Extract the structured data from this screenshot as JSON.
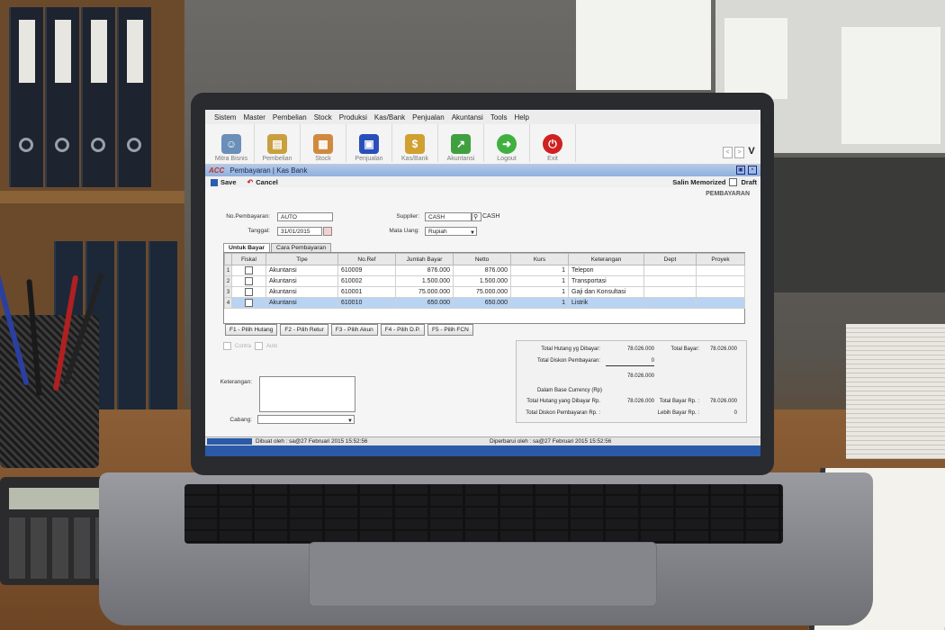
{
  "menu": [
    "Sistem",
    "Master",
    "Pembelian",
    "Stock",
    "Produksi",
    "Kas/Bank",
    "Penjualan",
    "Akuntansi",
    "Tools",
    "Help"
  ],
  "toolbar": [
    {
      "label": "Mitra Bisnis",
      "icon": "people-icon",
      "color": "#6a8fb8"
    },
    {
      "label": "Pembelian",
      "icon": "cart-icon",
      "color": "#c8a040"
    },
    {
      "label": "Stock",
      "icon": "boxes-icon",
      "color": "#d08a40"
    },
    {
      "label": "Penjualan",
      "icon": "bag-icon",
      "color": "#2a4fb8"
    },
    {
      "label": "Kas/Bank",
      "icon": "money-bag-icon",
      "color": "#d0a030"
    },
    {
      "label": "Akuntansi",
      "icon": "chart-icon",
      "color": "#40a040"
    },
    {
      "label": "Logout",
      "icon": "logout-icon",
      "color": "#40b040"
    },
    {
      "label": "Exit",
      "icon": "power-icon",
      "color": "#d02020"
    }
  ],
  "nav": {
    "prev": "<",
    "next": ">",
    "v": "V"
  },
  "window": {
    "logo": "ACC",
    "title": "Pembayaran | Kas Bank"
  },
  "actions": {
    "save": "Save",
    "cancel": "Cancel",
    "salin": "Salin Memorized",
    "draft": "Draft"
  },
  "form": {
    "heading": "PEMBAYARAN",
    "no_label": "No.Pembayaran:",
    "no_value": "AUTO",
    "tanggal_label": "Tanggal:",
    "tanggal_value": "31/01/2015",
    "supplier_label": "Supplier:",
    "supplier_value": "CASH",
    "supplier_name": "CASH",
    "mata_uang_label": "Mata Uang:",
    "mata_uang_value": "Rupiah",
    "keterangan_label": "Keterangan:",
    "cabang_label": "Cabang:",
    "contra": "Contra",
    "auto": "Auto"
  },
  "tabs": [
    "Untuk Bayar",
    "Cara Pembayaran"
  ],
  "grid": {
    "columns": [
      "Fiskal",
      "Tipe",
      "No.Ref",
      "Jumlah Bayar",
      "Netto",
      "Kurs",
      "Keterangan",
      "Dept",
      "Proyek"
    ],
    "rows": [
      {
        "n": "1",
        "tipe": "Akuntansi",
        "ref": "610009",
        "jumlah": "876.000",
        "netto": "876.000",
        "kurs": "1",
        "ket": "Telepon"
      },
      {
        "n": "2",
        "tipe": "Akuntansi",
        "ref": "610002",
        "jumlah": "1.500.000",
        "netto": "1.500.000",
        "kurs": "1",
        "ket": "Transportasi"
      },
      {
        "n": "3",
        "tipe": "Akuntansi",
        "ref": "610001",
        "jumlah": "75.000.000",
        "netto": "75.000.000",
        "kurs": "1",
        "ket": "Gaji dan Konsultasi"
      },
      {
        "n": "4",
        "tipe": "Akuntansi",
        "ref": "610010",
        "jumlah": "650.000",
        "netto": "650.000",
        "kurs": "1",
        "ket": "Listrik"
      }
    ]
  },
  "fbuttons": [
    "F1 - Pilih Hutang",
    "F2 - Pilih Retur",
    "F3 - Pilih Akun",
    "F4 - Pilih D.P.",
    "F5 - Pilih FCN"
  ],
  "totals": {
    "total_hutang_label": "Total Hutang yg Dibayar:",
    "total_hutang": "78.026.000",
    "total_bayar_label": "Total Bayar:",
    "total_bayar": "78.026.000",
    "total_diskon_label": "Total Diskon Pembayaran:",
    "total_diskon": "0",
    "subtotal": "78.026.000",
    "base_label": "Dalam Base Currency (Rp)",
    "hutang_rp_label": "Total Hutang yang Dibayar Rp.",
    "hutang_rp": "78.026.000",
    "bayar_rp_label": "Total Bayar Rp. :",
    "bayar_rp": "78.026.000",
    "diskon_rp_label": "Total Diskon Pembayaran Rp. :",
    "lebih_label": "Lebih Bayar Rp. :",
    "lebih": "0"
  },
  "status": {
    "created": "Dibuat oleh : sa@27 Februari 2015  15:52:56",
    "updated": "Diperbarui oleh : sa@27 Februari 2015  15:52:56"
  }
}
